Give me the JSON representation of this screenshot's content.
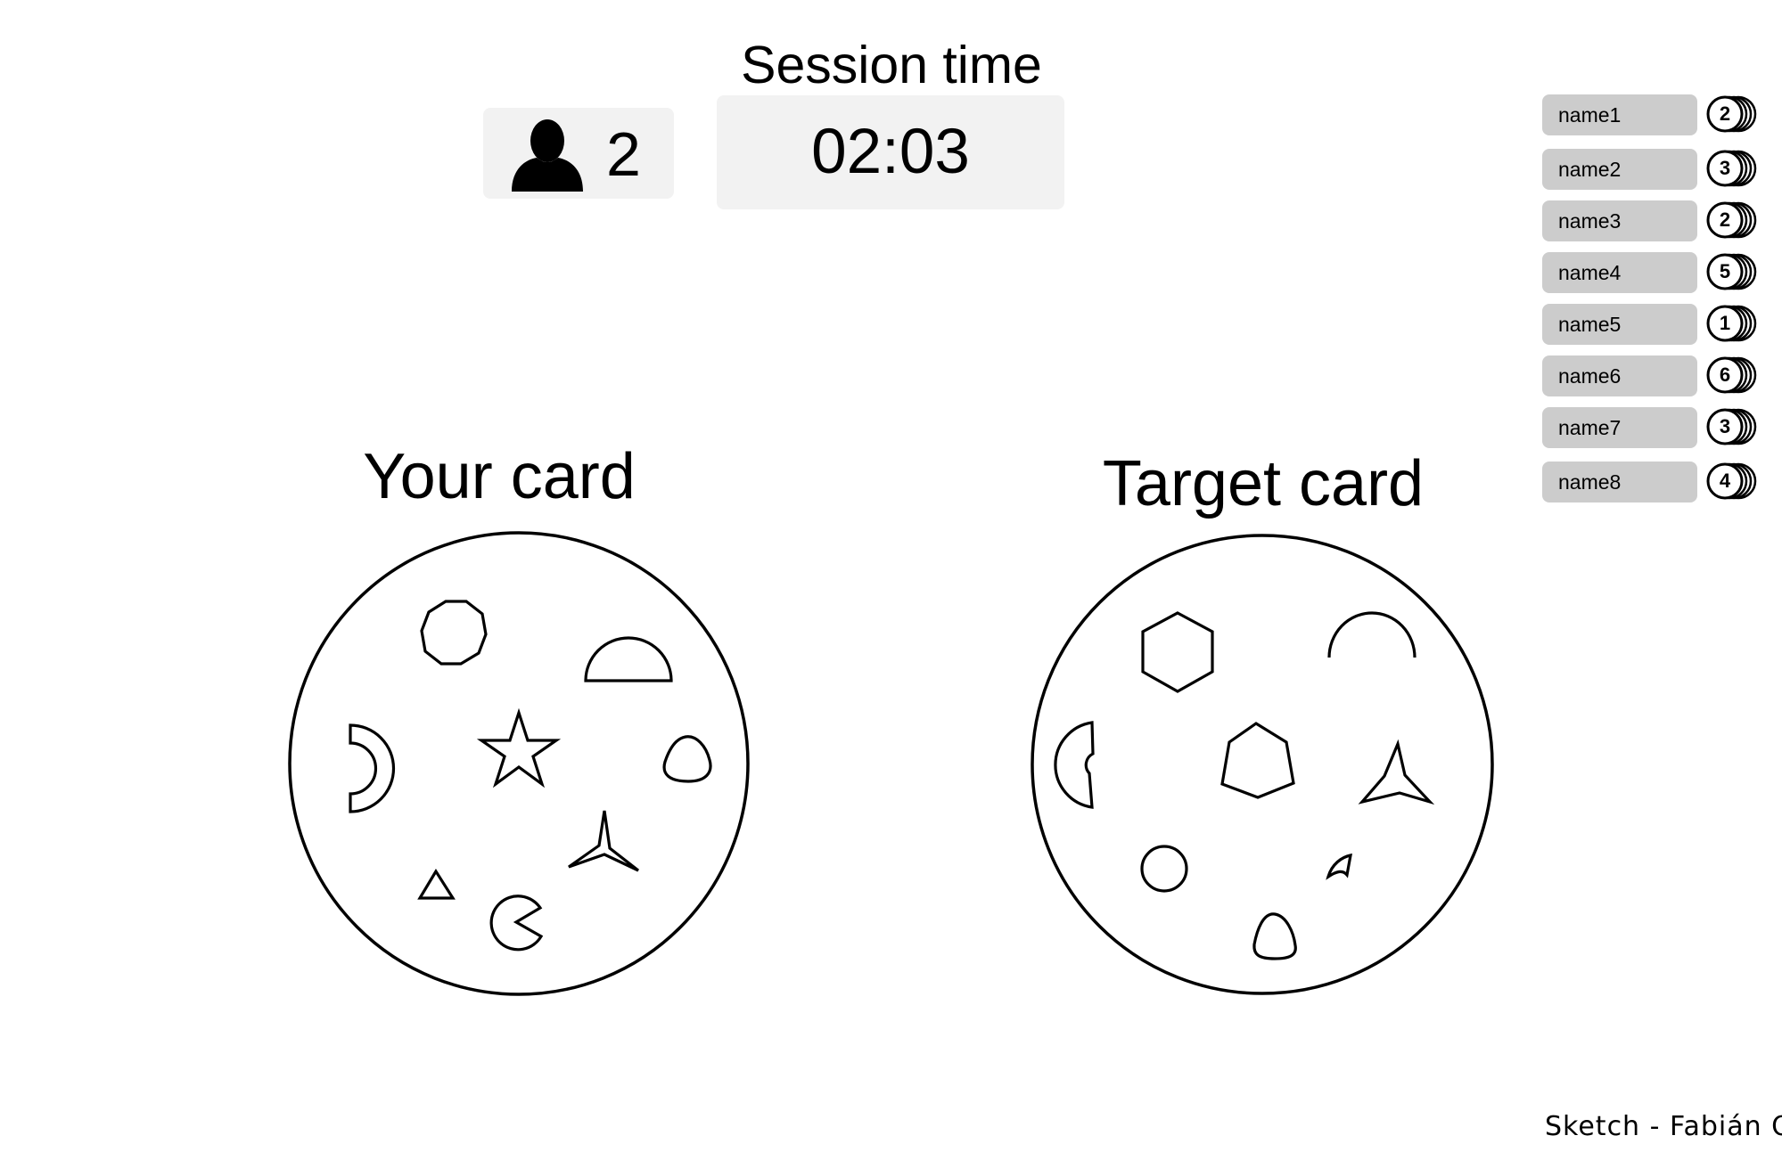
{
  "header": {
    "session_label": "Session time",
    "player_count": "2",
    "player_icon": "user-icon",
    "timer": "02:03"
  },
  "your_card": {
    "title": "Your card",
    "symbols": [
      "octagon",
      "half-circle",
      "crescent",
      "star",
      "rounded-triangle",
      "three-point-star",
      "triangle",
      "pacman"
    ]
  },
  "target_card": {
    "title": "Target card",
    "symbols": [
      "hexagon",
      "arc",
      "crescent",
      "pentagon",
      "three-point-star",
      "circle",
      "small-sector",
      "rounded-triangle"
    ]
  },
  "leaderboard": [
    {
      "name": "name1",
      "score": "2"
    },
    {
      "name": "name2",
      "score": "3"
    },
    {
      "name": "name3",
      "score": "2"
    },
    {
      "name": "name4",
      "score": "5"
    },
    {
      "name": "name5",
      "score": "1"
    },
    {
      "name": "name6",
      "score": "6"
    },
    {
      "name": "name7",
      "score": "3"
    },
    {
      "name": "name8",
      "score": "4"
    }
  ],
  "footer": {
    "signature": "Sketch - Fabián O."
  }
}
